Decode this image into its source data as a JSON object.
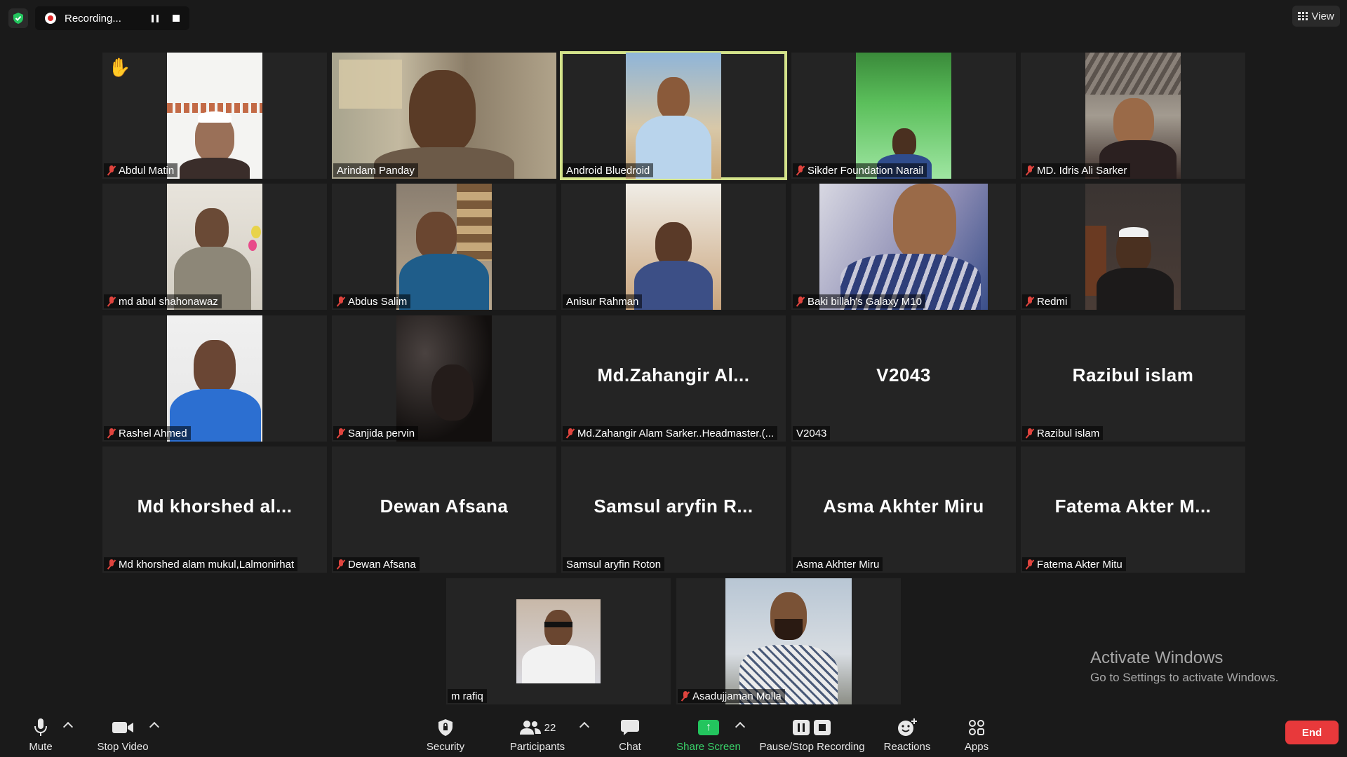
{
  "topbar": {
    "recording_label": "Recording...",
    "view_label": "View"
  },
  "tiles": [
    {
      "name": "Abdul Matin",
      "muted": true,
      "video": true,
      "hand_raised": true
    },
    {
      "name": "Arindam Panday",
      "muted": false,
      "video": true
    },
    {
      "name": "Android Bluedroid",
      "muted": false,
      "video": true,
      "active_speaker": true
    },
    {
      "name": "Sikder Foundation Narail",
      "muted": true,
      "video": true
    },
    {
      "name": "MD. Idris Ali Sarker",
      "muted": true,
      "video": true
    },
    {
      "name": "md abul shahonawaz",
      "muted": true,
      "video": true
    },
    {
      "name": "Abdus Salim",
      "muted": true,
      "video": true
    },
    {
      "name": "Anisur Rahman",
      "muted": false,
      "video": true
    },
    {
      "name": "Baki billah's Galaxy M10",
      "muted": true,
      "video": true
    },
    {
      "name": "Redmi",
      "muted": true,
      "video": true
    },
    {
      "name": "Rashel Ahmed",
      "muted": true,
      "video": true
    },
    {
      "name": "Sanjida pervin",
      "muted": true,
      "video": true
    },
    {
      "name": "Md.Zahangir Alam Sarker..Headmaster.(...",
      "display": "Md.Zahangir  Al...",
      "muted": true,
      "video": false
    },
    {
      "name": "V2043",
      "display": "V2043",
      "muted": false,
      "video": false
    },
    {
      "name": "Razibul islam",
      "display": "Razibul islam",
      "muted": true,
      "video": false
    },
    {
      "name": "Md khorshed alam mukul,Lalmonirhat",
      "display": "Md  khorshed  al...",
      "muted": true,
      "video": false
    },
    {
      "name": "Dewan Afsana",
      "display": "Dewan Afsana",
      "muted": true,
      "video": false
    },
    {
      "name": "Samsul aryfin Roton",
      "display": "Samsul aryfin R...",
      "muted": false,
      "video": false
    },
    {
      "name": "Asma Akhter Miru",
      "display": "Asma Akhter Miru",
      "muted": false,
      "video": false
    },
    {
      "name": "Fatema Akter Mitu",
      "display": "Fatema Akter M...",
      "muted": true,
      "video": false
    },
    {
      "name": "m rafiq",
      "muted": false,
      "video": true
    },
    {
      "name": "Asadujjaman Molla",
      "muted": true,
      "video": true
    }
  ],
  "toolbar": {
    "mute": "Mute",
    "stop_video": "Stop Video",
    "security": "Security",
    "participants": "Participants",
    "participants_count": "22",
    "chat": "Chat",
    "share_screen": "Share Screen",
    "pause_stop_recording": "Pause/Stop Recording",
    "reactions": "Reactions",
    "apps": "Apps",
    "end": "End"
  },
  "watermark": {
    "line1": "Activate Windows",
    "line2": "Go to Settings to activate Windows."
  },
  "colors": {
    "background": "#1a1a1a",
    "tile": "#242424",
    "active_outline": "#d3e28a",
    "share_green": "#23c55e",
    "end_red": "#e8393b",
    "muted_red": "#e0443e"
  }
}
